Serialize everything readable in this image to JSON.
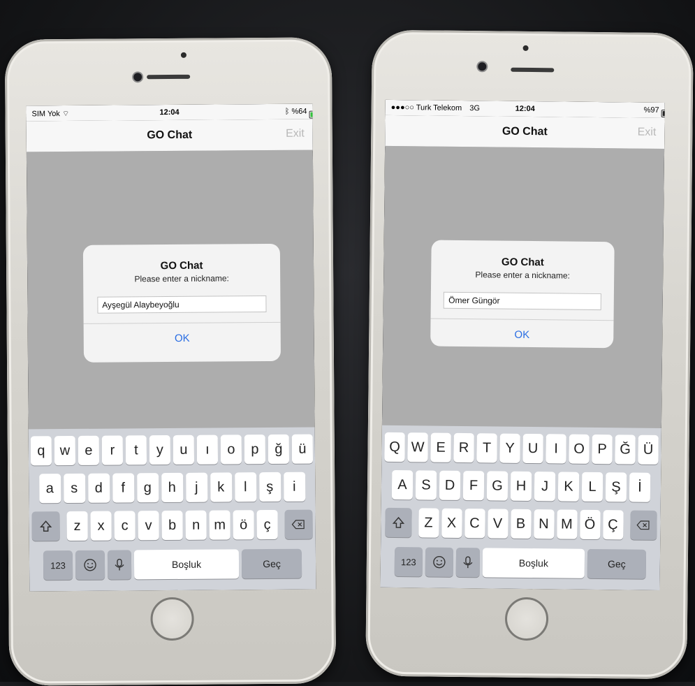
{
  "app": {
    "title": "GO Chat",
    "exit_label": "Exit"
  },
  "phones": [
    {
      "status": {
        "carrier": "SIM Yok",
        "time": "12:04",
        "battery_text": "%64"
      },
      "alert": {
        "title": "GO Chat",
        "message": "Please enter a nickname:",
        "input_value": "Ayşegül Alaybeyoğlu",
        "ok_label": "OK"
      },
      "keyboard": {
        "row1": [
          "q",
          "w",
          "e",
          "r",
          "t",
          "y",
          "u",
          "ı",
          "o",
          "p",
          "ğ",
          "ü"
        ],
        "row2": [
          "a",
          "s",
          "d",
          "f",
          "g",
          "h",
          "j",
          "k",
          "l",
          "ş",
          "i"
        ],
        "row3": [
          "z",
          "x",
          "c",
          "v",
          "b",
          "n",
          "m",
          "ö",
          "ç"
        ],
        "numbers_label": "123",
        "space_label": "Boşluk",
        "return_label": "Geç"
      }
    },
    {
      "status": {
        "carrier": "Turk Telekom",
        "network": "3G",
        "time": "12:04",
        "battery_text": "%97"
      },
      "alert": {
        "title": "GO Chat",
        "message": "Please enter a nickname:",
        "input_value": "Ömer Güngör",
        "ok_label": "OK"
      },
      "keyboard": {
        "row1": [
          "Q",
          "W",
          "E",
          "R",
          "T",
          "Y",
          "U",
          "I",
          "O",
          "P",
          "Ğ",
          "Ü"
        ],
        "row2": [
          "A",
          "S",
          "D",
          "F",
          "G",
          "H",
          "J",
          "K",
          "L",
          "Ş",
          "İ"
        ],
        "row3": [
          "Z",
          "X",
          "C",
          "V",
          "B",
          "N",
          "M",
          "Ö",
          "Ç"
        ],
        "numbers_label": "123",
        "space_label": "Boşluk",
        "return_label": "Geç"
      }
    }
  ],
  "icons": {
    "shift": "shift-icon",
    "delete": "backspace-icon",
    "emoji": "emoji-icon",
    "mic": "microphone-icon",
    "wifi": "wifi-icon",
    "bluetooth": "bluetooth-icon"
  },
  "colors": {
    "accent": "#2a6ee3",
    "battery_charging": "#32c13b",
    "keyboard_bg": "#d0d3d9"
  }
}
